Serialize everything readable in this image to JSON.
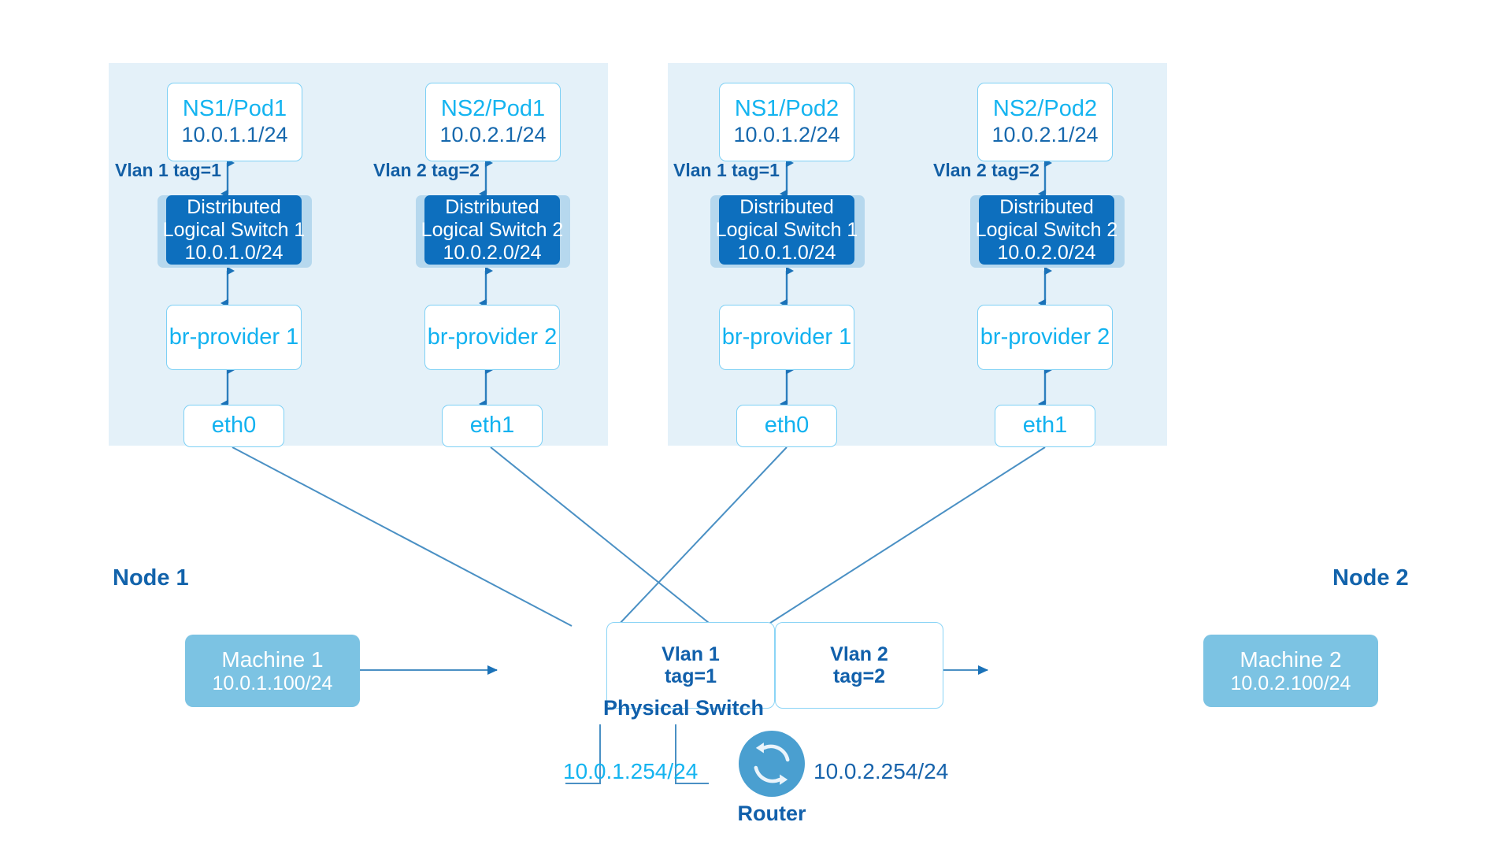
{
  "diagram": {
    "title": "Kube-OVN VLAN underlay network topology",
    "colors": {
      "panel_bg": "#e4f1f9",
      "accent_cyan": "#14b4f0",
      "accent_blue": "#1160ab",
      "switch_fill": "#0d6fbe",
      "switch_shadow": "#b6d8ee",
      "machine_fill": "#7cc3e3",
      "edge_stroke": "#4a90c4",
      "arrow_fill": "#1b72b8",
      "router_fill": "#4a9fd0"
    }
  },
  "nodes": [
    {
      "caption": "Node 1",
      "columns": [
        {
          "pod": {
            "name": "NS1/Pod1",
            "ip": "10.0.1.1/24"
          },
          "vlan_caption": "Vlan 1 tag=1",
          "switch": {
            "line1": "Distributed",
            "line2": "Logical Switch 1",
            "line3": "10.0.1.0/24"
          },
          "bridge": "br-provider 1",
          "iface": "eth0"
        },
        {
          "pod": {
            "name": "NS2/Pod1",
            "ip": "10.0.2.1/24"
          },
          "vlan_caption": "Vlan 2 tag=2",
          "switch": {
            "line1": "Distributed",
            "line2": "Logical Switch 2",
            "line3": "10.0.2.0/24"
          },
          "bridge": "br-provider 2",
          "iface": "eth1"
        }
      ]
    },
    {
      "caption": "Node 2",
      "columns": [
        {
          "pod": {
            "name": "NS1/Pod2",
            "ip": "10.0.1.2/24"
          },
          "vlan_caption": "Vlan 1 tag=1",
          "switch": {
            "line1": "Distributed",
            "line2": "Logical Switch 1",
            "line3": "10.0.1.0/24"
          },
          "bridge": "br-provider 1",
          "iface": "eth0"
        },
        {
          "pod": {
            "name": "NS2/Pod2",
            "ip": "10.0.2.1/24"
          },
          "vlan_caption": "Vlan 2 tag=2",
          "switch": {
            "line1": "Distributed",
            "line2": "Logical Switch 2",
            "line3": "10.0.2.0/24"
          },
          "bridge": "br-provider 2",
          "iface": "eth1"
        }
      ]
    }
  ],
  "machines": [
    {
      "name": "Machine 1",
      "ip": "10.0.1.100/24"
    },
    {
      "name": "Machine 2",
      "ip": "10.0.2.100/24"
    }
  ],
  "physical_switch": {
    "caption": "Physical Switch",
    "ports": [
      {
        "line1": "Vlan 1",
        "line2": "tag=1"
      },
      {
        "line1": "Vlan 2",
        "line2": "tag=2"
      }
    ]
  },
  "router": {
    "caption": "Router",
    "icon": "router-sync-icon",
    "ip_left": "10.0.1.254/24",
    "ip_right": "10.0.2.254/24"
  }
}
